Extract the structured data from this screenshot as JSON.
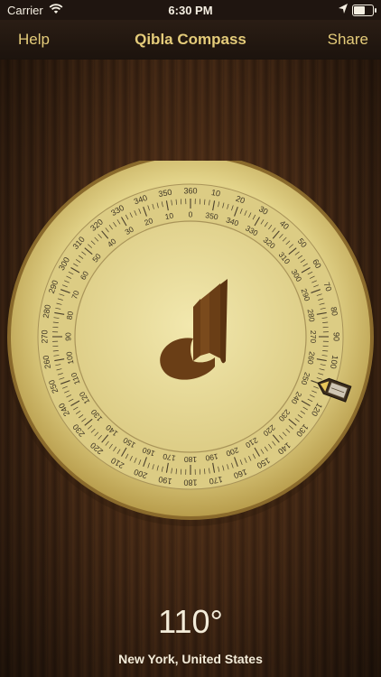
{
  "status_bar": {
    "carrier": "Carrier",
    "time": "6:30 PM"
  },
  "nav": {
    "help_label": "Help",
    "title": "Qibla Compass",
    "share_label": "Share"
  },
  "compass": {
    "outer_labels": [
      "360",
      "10",
      "20",
      "30",
      "40",
      "50",
      "60",
      "70",
      "80",
      "90",
      "100",
      "110",
      "120",
      "130",
      "140",
      "150",
      "160",
      "170",
      "180",
      "190",
      "200",
      "210",
      "220",
      "230",
      "240",
      "250",
      "260",
      "270",
      "280",
      "290",
      "300",
      "310",
      "320",
      "330",
      "340",
      "350"
    ],
    "inner_labels": [
      "0",
      "350",
      "340",
      "330",
      "320",
      "310",
      "300",
      "290",
      "280",
      "270",
      "260",
      "250",
      "240",
      "230",
      "220",
      "210",
      "200",
      "190",
      "180",
      "170",
      "160",
      "150",
      "140",
      "130",
      "120",
      "110",
      "100",
      "90",
      "80",
      "70",
      "60",
      "50",
      "40",
      "30",
      "20",
      "10"
    ],
    "dial_rotation_deg": 0,
    "marker_bearing_deg": 110
  },
  "heading_text": "110°",
  "location_text": "New York, United States",
  "colors": {
    "accent": "#e5cc7a",
    "dial_face": "#e9dd98",
    "logo": "#6a3e16"
  }
}
